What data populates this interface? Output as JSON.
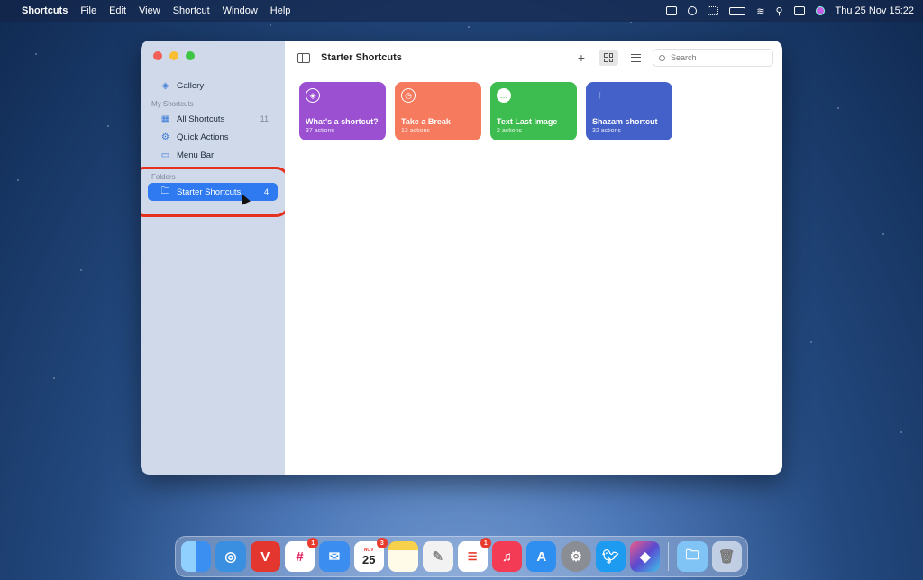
{
  "menubar": {
    "app_name": "Shortcuts",
    "items": [
      "File",
      "Edit",
      "View",
      "Shortcut",
      "Window",
      "Help"
    ],
    "datetime": "Thu 25 Nov  15:22"
  },
  "sidebar": {
    "gallery": "Gallery",
    "my_shortcuts_header": "My Shortcuts",
    "all_shortcuts": "All Shortcuts",
    "all_shortcuts_count": "11",
    "quick_actions": "Quick Actions",
    "menu_bar": "Menu Bar",
    "folders_header": "Folders",
    "starter_shortcuts": "Starter Shortcuts",
    "starter_shortcuts_count": "4"
  },
  "toolbar": {
    "title": "Starter Shortcuts",
    "add": "+",
    "search_placeholder": "Search"
  },
  "cards": [
    {
      "name": "What's a shortcut?",
      "actions": "37 actions",
      "color": "#9b4fd1",
      "icon": "layers-icon"
    },
    {
      "name": "Take a Break",
      "actions": "13 actions",
      "color": "#f57a5e",
      "icon": "timer-icon"
    },
    {
      "name": "Text Last Image",
      "actions": "2 actions",
      "color": "#3dbd4f",
      "icon": "message-icon"
    },
    {
      "name": "Shazam shortcut",
      "actions": "32 actions",
      "color": "#4460c9",
      "icon": "waveform-icon"
    }
  ],
  "dock": {
    "apps": [
      {
        "name": "finder",
        "color": "#4aa0f0"
      },
      {
        "name": "safari",
        "color": "#3a8fe0"
      },
      {
        "name": "vivaldi",
        "color": "#e2362e"
      },
      {
        "name": "slack",
        "color": "#ffffff",
        "badge": "1"
      },
      {
        "name": "mail",
        "color": "#3b8ef0"
      },
      {
        "name": "calendar",
        "color": "#ffffff",
        "badge": "3",
        "label": "25",
        "month": "NOV"
      },
      {
        "name": "notes",
        "color": "#f8d14a"
      },
      {
        "name": "textedit",
        "color": "#f2f2f2"
      },
      {
        "name": "reminders",
        "color": "#ffffff",
        "badge": "1"
      },
      {
        "name": "music",
        "color": "#f43b55"
      },
      {
        "name": "app-store",
        "color": "#2f8ff0"
      },
      {
        "name": "system-preferences",
        "color": "#8a8d93"
      },
      {
        "name": "twitter",
        "color": "#1d9bf0"
      },
      {
        "name": "shortcuts",
        "color": "#5a4ad0"
      }
    ]
  }
}
